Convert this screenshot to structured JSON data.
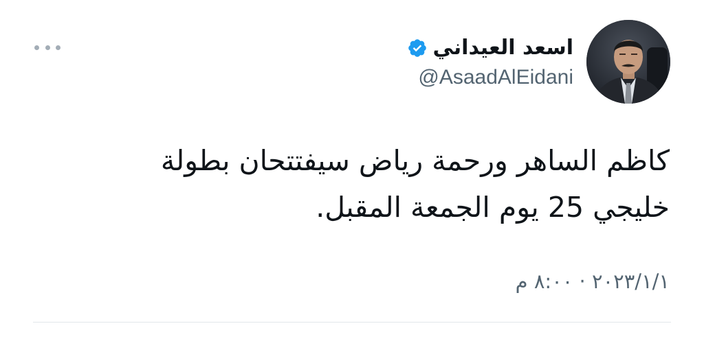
{
  "tweet": {
    "author": {
      "display_name": "اسعد العيداني",
      "handle": "@AsaadAlEidani",
      "verified": true,
      "avatar_icon": "profile-photo"
    },
    "text_lines": [
      "كاظم الساهر ورحمة رياض سيفتتحان بطولة",
      "خليجي 25 يوم الجمعة المقبل."
    ],
    "timestamp": "٢٠٢٣/١/١ · ٨:٠٠ م",
    "more_icon": "more-horizontal-icon",
    "colors": {
      "verified": "#1d9bf0",
      "text": "#0f1419",
      "secondary": "#536471",
      "divider": "#e1e6ea"
    }
  }
}
